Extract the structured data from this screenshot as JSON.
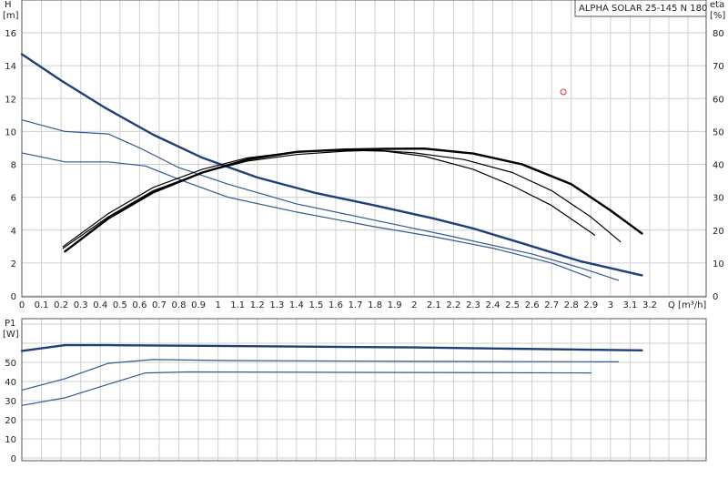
{
  "chart_data": [
    {
      "type": "line",
      "title": "ALPHA SOLAR 25-145 N 180",
      "ylabel": "H",
      "yunit": "[m]",
      "y2label": "eta",
      "y2unit": "[%]",
      "xlabel": "Q [m³/h]",
      "xlim": [
        0,
        3.2
      ],
      "ylim": [
        0,
        16
      ],
      "y2lim": [
        0,
        80
      ],
      "grid": true,
      "x_ticks": [
        "0",
        "0.1",
        "0.2",
        "0.3",
        "0.4",
        "0.5",
        "0.6",
        "0.7",
        "0.8",
        "0.9",
        "1",
        "1.1",
        "1.2",
        "1.3",
        "1.4",
        "1.5",
        "1.6",
        "1.7",
        "1.8",
        "1.9",
        "2",
        "2.1",
        "2.2",
        "2.3",
        "2.4",
        "2.5",
        "2.6",
        "2.7",
        "2.8",
        "2.9",
        "3",
        "3.1",
        "3.2"
      ],
      "y_ticks": [
        "0",
        "2",
        "4",
        "6",
        "8",
        "10",
        "12",
        "14",
        "16"
      ],
      "y2_ticks": [
        "0",
        "10",
        "20",
        "30",
        "40",
        "50",
        "60",
        "70",
        "80"
      ],
      "series": [
        {
          "axis": "H",
          "color": "#1f3f77",
          "weight": "bold",
          "x": [
            0,
            0.2,
            0.43,
            0.67,
            0.92,
            1.2,
            1.5,
            1.8,
            2.1,
            2.3,
            2.55,
            2.85,
            3.16
          ],
          "y": [
            14.7,
            13.1,
            11.4,
            9.8,
            8.4,
            7.2,
            6.25,
            5.5,
            4.7,
            4.1,
            3.2,
            2.1,
            1.25
          ]
        },
        {
          "axis": "H",
          "color": "#2f5a8f",
          "weight": "thin",
          "x": [
            0,
            0.22,
            0.44,
            0.6,
            0.8,
            1.05,
            1.4,
            1.8,
            2.2,
            2.6,
            2.85,
            3.04
          ],
          "y": [
            10.7,
            10.0,
            9.85,
            9.0,
            7.8,
            6.8,
            5.6,
            4.6,
            3.6,
            2.55,
            1.7,
            0.95
          ]
        },
        {
          "axis": "H",
          "color": "#2f5a8f",
          "weight": "thin",
          "x": [
            0,
            0.22,
            0.44,
            0.63,
            0.82,
            1.05,
            1.4,
            1.8,
            2.1,
            2.4,
            2.7,
            2.9
          ],
          "y": [
            8.7,
            8.15,
            8.15,
            7.9,
            7.0,
            6.0,
            5.1,
            4.2,
            3.6,
            2.9,
            2.0,
            1.1
          ]
        },
        {
          "axis": "eta",
          "color": "#000000",
          "weight": "bold",
          "x": [
            0.22,
            0.44,
            0.67,
            0.92,
            1.15,
            1.4,
            1.65,
            1.85,
            2.05,
            2.3,
            2.55,
            2.8,
            3.0,
            3.16
          ],
          "y": [
            13.5,
            23.5,
            31.5,
            37.5,
            41.5,
            43.8,
            44.5,
            44.7,
            44.8,
            43.3,
            40.0,
            34.0,
            26.0,
            19.0
          ]
        },
        {
          "axis": "eta",
          "color": "#000000",
          "weight": "thin",
          "x": [
            0.21,
            0.44,
            0.67,
            0.92,
            1.15,
            1.4,
            1.65,
            1.8,
            2.0,
            2.25,
            2.5,
            2.7,
            2.9,
            3.05
          ],
          "y": [
            14.5,
            24.0,
            32.0,
            37.5,
            41.0,
            43.0,
            44.0,
            44.3,
            43.5,
            41.5,
            37.5,
            32.0,
            24.0,
            16.5
          ]
        },
        {
          "axis": "eta",
          "color": "#000000",
          "weight": "thin",
          "x": [
            0.21,
            0.44,
            0.67,
            0.92,
            1.15,
            1.4,
            1.65,
            1.85,
            2.05,
            2.3,
            2.5,
            2.7,
            2.92
          ],
          "y": [
            15.0,
            25.0,
            33.0,
            38.5,
            42.0,
            43.8,
            44.3,
            44.0,
            42.5,
            38.5,
            33.5,
            27.5,
            18.5
          ]
        }
      ],
      "marker": {
        "x": 2.76,
        "y2": 62,
        "color": "#dd3333"
      }
    },
    {
      "type": "line",
      "ylabel": "P1",
      "yunit": "[W]",
      "xlim": [
        0,
        3.2
      ],
      "ylim": [
        0,
        70
      ],
      "grid": true,
      "y_ticks": [
        "0",
        "10",
        "20",
        "30",
        "40",
        "50"
      ],
      "series": [
        {
          "color": "#1f3f77",
          "weight": "bold",
          "x": [
            0,
            0.22,
            0.44,
            1.0,
            2.0,
            3.16
          ],
          "y": [
            56.0,
            59.0,
            59.0,
            58.6,
            57.8,
            56.3
          ]
        },
        {
          "color": "#2f5a8f",
          "weight": "thin",
          "x": [
            0,
            0.22,
            0.44,
            0.67,
            1.0,
            2.0,
            3.04
          ],
          "y": [
            35.5,
            41.5,
            49.5,
            51.5,
            51.0,
            50.5,
            50.3
          ]
        },
        {
          "color": "#2f5a8f",
          "weight": "thin",
          "x": [
            0,
            0.22,
            0.44,
            0.63,
            0.85,
            1.5,
            2.9
          ],
          "y": [
            27.5,
            31.5,
            38.5,
            44.5,
            45.0,
            44.8,
            44.5
          ]
        }
      ]
    }
  ]
}
